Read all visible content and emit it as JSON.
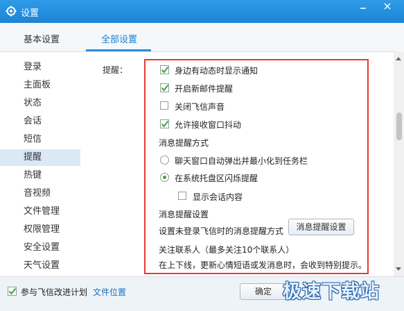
{
  "window": {
    "title": "设置"
  },
  "tabs": [
    {
      "label": "基本设置"
    },
    {
      "label": "全部设置"
    }
  ],
  "sidebar": {
    "items": [
      {
        "label": "登录"
      },
      {
        "label": "主面板"
      },
      {
        "label": "状态"
      },
      {
        "label": "会话"
      },
      {
        "label": "短信"
      },
      {
        "label": "提醒"
      },
      {
        "label": "热键"
      },
      {
        "label": "音视频"
      },
      {
        "label": "文件管理"
      },
      {
        "label": "权限管理"
      },
      {
        "label": "安全设置"
      },
      {
        "label": "天气设置"
      }
    ],
    "active_index": 5
  },
  "content": {
    "section_label": "提醒：",
    "checkboxes": [
      {
        "label": "身边有动态时显示通知",
        "checked": true
      },
      {
        "label": "开启新邮件提醒",
        "checked": true
      },
      {
        "label": "关闭飞信声音",
        "checked": false
      },
      {
        "label": "允许接收窗口抖动",
        "checked": true
      }
    ],
    "notify_method": {
      "heading": "消息提醒方式",
      "options": [
        {
          "label": "聊天窗口自动弹出并最小化到任务栏",
          "selected": false
        },
        {
          "label": "在系统托盘区闪烁提醒",
          "selected": true
        }
      ],
      "show_content": {
        "label": "显示会话内容",
        "checked": false
      }
    },
    "notify_settings": {
      "heading": "消息提醒设置",
      "description": "设置未登录飞信时的消息提醒方式",
      "button": "消息提醒设置"
    },
    "follow": {
      "heading": "关注联系人（最多关注10个联系人）",
      "description": "在上下线，更新心情短语或发消息时，会收到特别提示。"
    }
  },
  "footer": {
    "improve_label": "参与飞信改进计划",
    "improve_checked": true,
    "file_location": "文件位置",
    "ok_button": "确定"
  },
  "watermark": "极速下载站",
  "colors": {
    "titlebar": "#1b84d6",
    "accent": "#2b8ee0",
    "check": "#3aa63a",
    "highlight_box": "#e53935"
  }
}
